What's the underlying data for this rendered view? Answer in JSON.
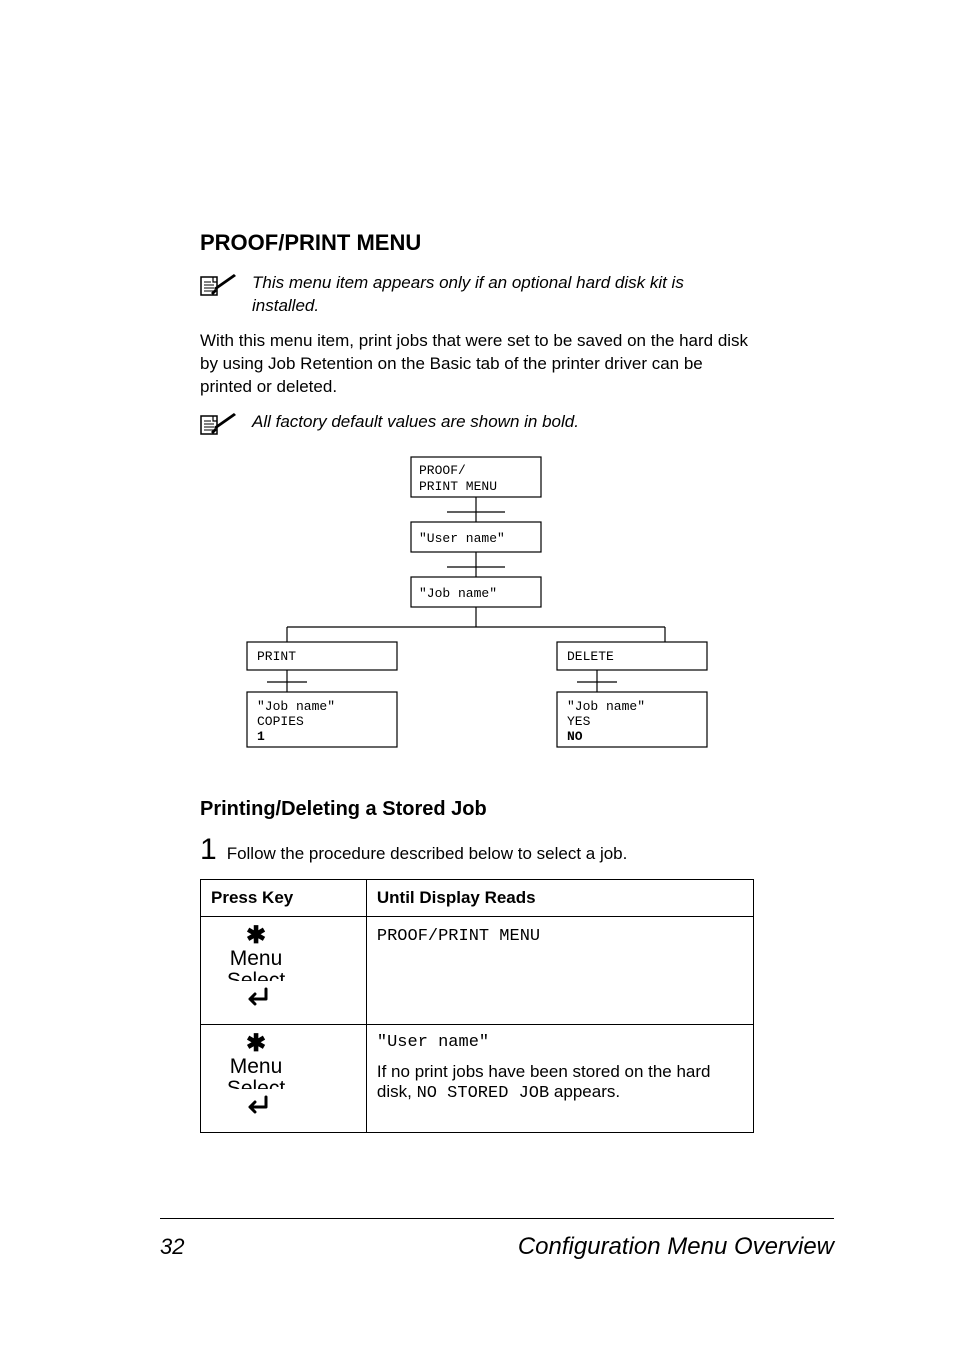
{
  "headings": {
    "h1": "PROOF/PRINT MENU",
    "h2": "Printing/Deleting a Stored Job"
  },
  "notes": {
    "n1": "This menu item appears only if an optional hard disk kit is installed.",
    "n2": "All factory default values are shown in bold."
  },
  "body": {
    "p1": "With this menu item, print jobs that were set to be saved on the hard disk by using Job Retention on the Basic tab of the printer driver can be printed or deleted."
  },
  "diagram": {
    "root_l1": "PROOF/",
    "root_l2": "PRINT MENU",
    "user": "\"User name\"",
    "job": "\"Job name\"",
    "print": "PRINT",
    "delete": "DELETE",
    "print_detail_l1": "\"Job name\"",
    "print_detail_l2": "COPIES",
    "print_detail_l3": "1",
    "delete_detail_l1": "\"Job name\"",
    "delete_detail_l2": "YES",
    "delete_detail_l3": "NO"
  },
  "step": {
    "num": "1",
    "text": "Follow the procedure described below to select a job."
  },
  "table": {
    "col1": "Press Key",
    "col2": "Until Display Reads",
    "r1c2": "PROOF/PRINT MENU",
    "r2c2_l1": "\"User name\"",
    "r2c2_desc_pre": "If no print jobs have been stored on the hard disk, ",
    "r2c2_code": "NO STORED JOB",
    "r2c2_desc_post": " appears.",
    "menu": "Menu",
    "select": "Select"
  },
  "footer": {
    "page": "32",
    "title": "Configuration Menu Overview"
  }
}
